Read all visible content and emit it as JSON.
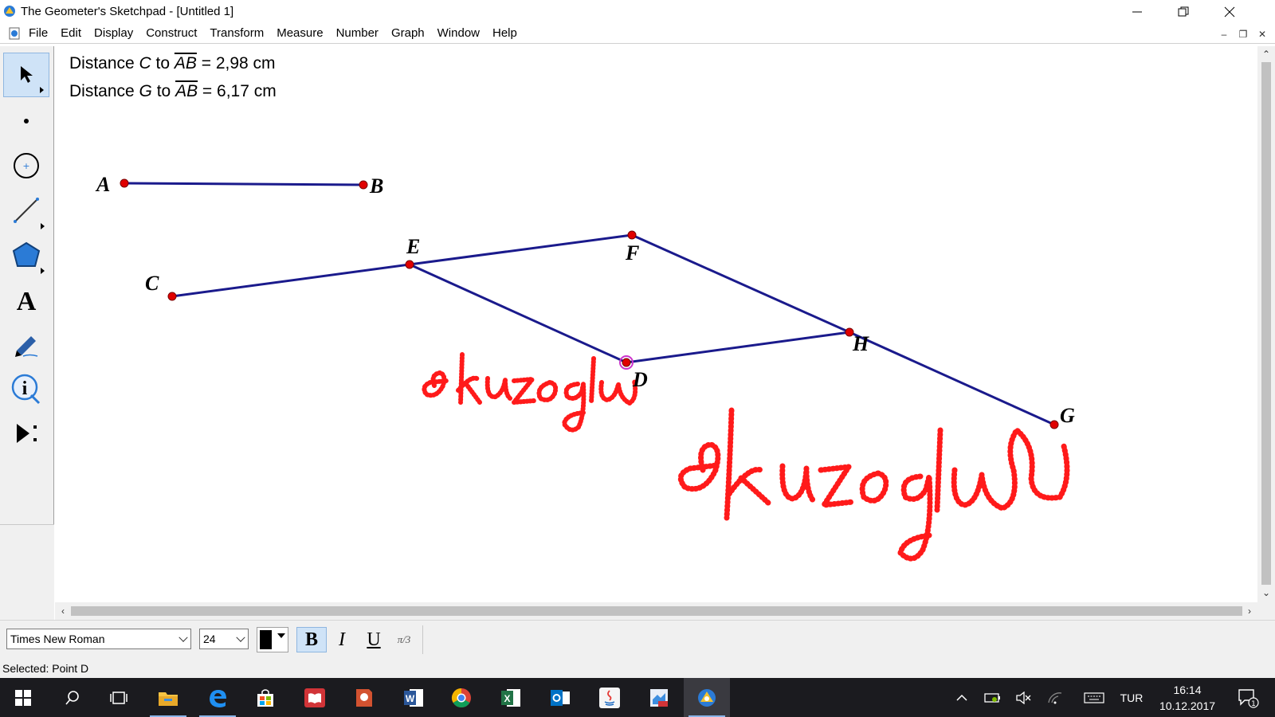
{
  "window": {
    "title": "The Geometer's Sketchpad - [Untitled 1]"
  },
  "menu": [
    "File",
    "Edit",
    "Display",
    "Construct",
    "Transform",
    "Measure",
    "Number",
    "Graph",
    "Window",
    "Help"
  ],
  "toolbox": {
    "tools": [
      "selection-arrow",
      "point",
      "compass",
      "straightedge",
      "polygon",
      "text",
      "marker",
      "information",
      "custom"
    ],
    "selected": "selection-arrow"
  },
  "measurements": [
    {
      "prefix": "Distance ",
      "point": "C",
      "mid": " to ",
      "segment": "AB",
      "suffix": " = 2,98 cm"
    },
    {
      "prefix": "Distance ",
      "point": "G",
      "mid": " to ",
      "segment": "AB",
      "suffix": " = 6,17 cm"
    }
  ],
  "points": {
    "A": "A",
    "B": "B",
    "C": "C",
    "D": "D",
    "E": "E",
    "F": "F",
    "G": "G",
    "H": "H"
  },
  "handwriting": [
    "ekuzoglu",
    "ekuzoglu"
  ],
  "format_bar": {
    "font": "Times New Roman",
    "size": "24",
    "bold": "B",
    "italic": "I",
    "underline": "U",
    "math_format": "π/3"
  },
  "status": {
    "text": "Selected: Point D"
  },
  "taskbar": {
    "apps": [
      "start",
      "search",
      "task-view",
      "file-explorer",
      "edge",
      "store",
      "reader",
      "powerpoint-like",
      "word",
      "chrome",
      "excel",
      "outlook",
      "java",
      "pdf",
      "geometers-sketchpad"
    ],
    "tray": {
      "language": "TUR",
      "time": "16:14",
      "date": "10.12.2017",
      "notifications": "1"
    }
  },
  "colors": {
    "segment": "#1a1a8c",
    "point": "#e00000",
    "ink": "#ff0000",
    "selection": "#cc33cc",
    "taskbar": "#1b1b1f"
  }
}
